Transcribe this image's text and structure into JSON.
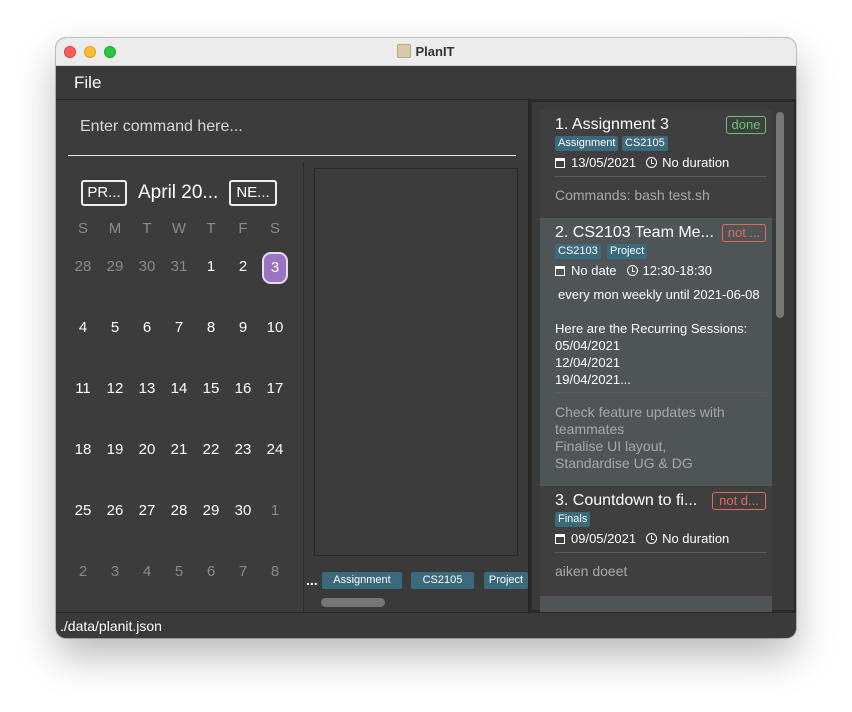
{
  "window": {
    "title": "PlanIT"
  },
  "menu": {
    "file": "File"
  },
  "command": {
    "placeholder": "Enter command here..."
  },
  "calendar": {
    "prev": "PR...",
    "next": "NE...",
    "month": "April 20...",
    "weekdays": [
      "S",
      "M",
      "T",
      "W",
      "T",
      "F",
      "S"
    ],
    "weeks": [
      [
        "28",
        "29",
        "30",
        "31",
        "1",
        "2",
        "3"
      ],
      [
        "4",
        "5",
        "6",
        "7",
        "8",
        "9",
        "10"
      ],
      [
        "11",
        "12",
        "13",
        "14",
        "15",
        "16",
        "17"
      ],
      [
        "18",
        "19",
        "20",
        "21",
        "22",
        "23",
        "24"
      ],
      [
        "25",
        "26",
        "27",
        "28",
        "29",
        "30",
        "1"
      ],
      [
        "2",
        "3",
        "4",
        "5",
        "6",
        "7",
        "8"
      ]
    ],
    "today": "3"
  },
  "tag_bar": {
    "ellipsis": "...",
    "tags": [
      "Assignment",
      "CS2105",
      "Project"
    ]
  },
  "tasks": [
    {
      "title": "1.  Assignment 3",
      "status": "done",
      "tags": [
        "Assignment",
        "CS2105"
      ],
      "date": "13/05/2021",
      "duration": "No duration",
      "description": "Commands: bash test.sh"
    },
    {
      "title": "2.  CS2103 Team Me...",
      "status": "not ...",
      "tags": [
        "CS2103",
        "Project"
      ],
      "date": "No date",
      "duration": "12:30-18:30",
      "recurrence": "every mon weekly until 2021-06-08",
      "sessions_heading": "Here are the Recurring Sessions:",
      "sessions": [
        "05/04/2021",
        "12/04/2021",
        "19/04/2021..."
      ],
      "description": [
        "Check feature updates with",
        "teammates",
        "Finalise UI layout,",
        "Standardise UG & DG"
      ]
    },
    {
      "title": "3.  Countdown to fi...",
      "status": "not d...",
      "tags": [
        "Finals"
      ],
      "date": "09/05/2021",
      "duration": "No duration",
      "description": "aiken doeet"
    }
  ],
  "status_bar": {
    "path": "./data/planit.json"
  },
  "colors": {
    "background": "#3a3a3a",
    "accent_today": "#9b72c4",
    "tag": "#3b6a7d",
    "done": "#67c46e",
    "not_done": "#e26b5f"
  }
}
